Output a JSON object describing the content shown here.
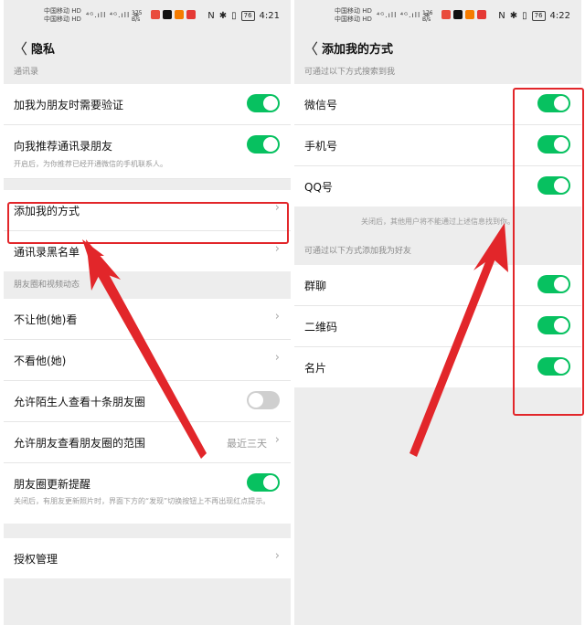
{
  "left": {
    "status": {
      "carrier_top": "中国移动 HD",
      "carrier_bottom": "中国移动 HD",
      "signal": "⁴ᴳ.ıll ⁴ᴳ.ıll ≋",
      "speed": "375 B/s",
      "battery": "76",
      "time": "4:21"
    },
    "title": "隐私",
    "sections": [
      {
        "header": "通讯录",
        "items": [
          {
            "label": "加我为朋友时需要验证",
            "toggle": true
          },
          {
            "label": "向我推荐通讯录朋友",
            "toggle": true,
            "sub": "开启后，为你推荐已经开通微信的手机联系人。"
          },
          {
            "label": "添加我的方式",
            "chevron": true
          },
          {
            "label": "通讯录黑名单",
            "chevron": true
          }
        ]
      },
      {
        "header": "朋友圈和视频动态",
        "items": [
          {
            "label": "不让他(她)看",
            "chevron": true
          },
          {
            "label": "不看他(她)",
            "chevron": true
          },
          {
            "label": "允许陌生人查看十条朋友圈",
            "toggle": false
          },
          {
            "label": "允许朋友查看朋友圈的范围",
            "value": "最近三天",
            "chevron": true
          },
          {
            "label": "朋友圈更新提醒",
            "toggle": true,
            "sub": "关闭后，有朋友更新照片时，界面下方的“发现”切换按钮上不再出现红点提示。"
          }
        ]
      },
      {
        "items": [
          {
            "label": "授权管理",
            "chevron": true
          }
        ]
      }
    ]
  },
  "right": {
    "status": {
      "carrier_top": "中国移动 HD",
      "carrier_bottom": "中国移动 HD",
      "signal": "⁴ᴳ.ıll ⁴ᴳ.ıll ≋",
      "speed": "176 B/s",
      "battery": "76",
      "time": "4:22"
    },
    "title": "添加我的方式",
    "section1_header": "可通过以下方式搜索到我",
    "section1_items": [
      {
        "label": "微信号",
        "toggle": true
      },
      {
        "label": "手机号",
        "toggle": true
      },
      {
        "label": "QQ号",
        "toggle": true
      }
    ],
    "note": "关闭后，其他用户将不能通过上述信息找到你。",
    "section2_header": "可通过以下方式添加我为好友",
    "section2_items": [
      {
        "label": "群聊",
        "toggle": true
      },
      {
        "label": "二维码",
        "toggle": true
      },
      {
        "label": "名片",
        "toggle": true
      }
    ]
  },
  "annotation_color": "#e2262a",
  "toggle_on_color": "#07c160"
}
